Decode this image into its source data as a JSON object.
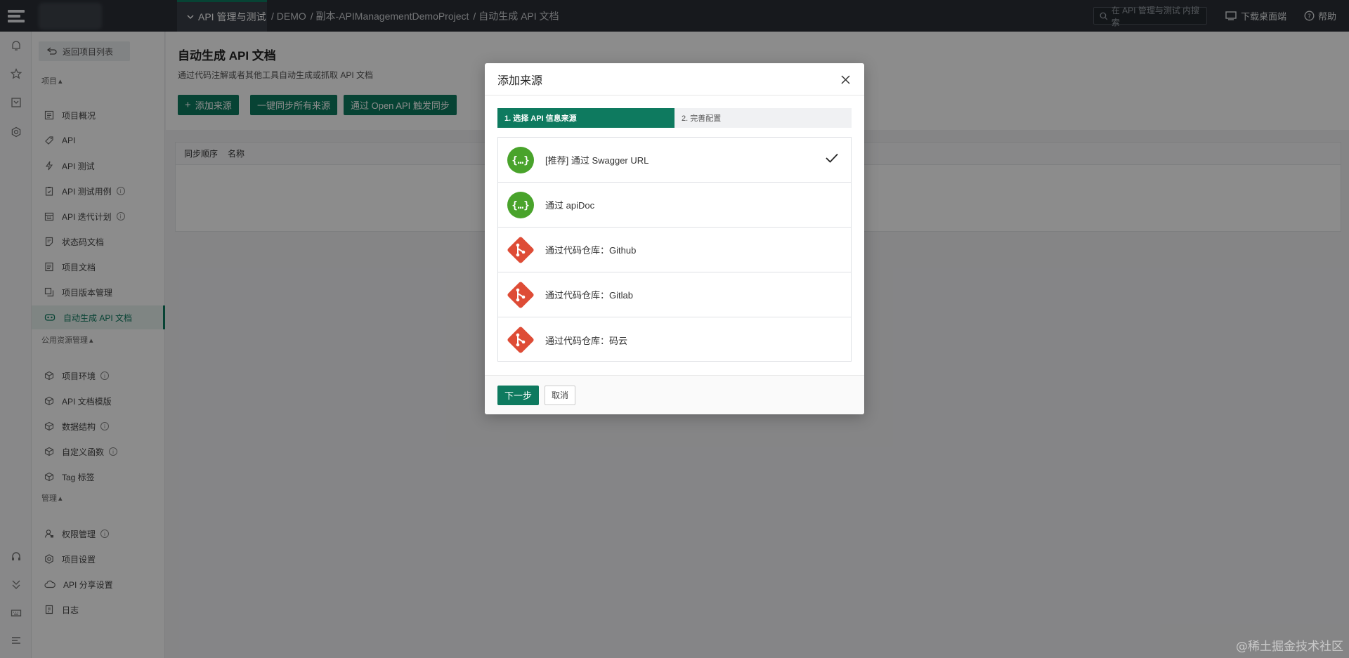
{
  "topbar": {
    "module_label": "API 管理与测试",
    "breadcrumbs": [
      "/ DEMO",
      "/ 副本-APIManagementDemoProject",
      "/ 自动生成 API 文档"
    ],
    "search_placeholder": "在 API 管理与测试 内搜索",
    "download_label": "下载桌面端",
    "help_label": "帮助"
  },
  "sidebar": {
    "back_label": "返回项目列表",
    "sections": [
      {
        "label": "项目",
        "items": [
          {
            "label": "项目概况",
            "icon": "overview-icon",
            "info": false
          },
          {
            "label": "API",
            "icon": "api-tag-icon",
            "info": false
          },
          {
            "label": "API 测试",
            "icon": "lightning-icon",
            "info": false
          },
          {
            "label": "API 测试用例",
            "icon": "clipboard-icon",
            "info": true
          },
          {
            "label": "API 迭代计划",
            "icon": "calendar-icon",
            "info": true
          },
          {
            "label": "状态码文档",
            "icon": "code-doc-icon",
            "info": false
          },
          {
            "label": "项目文档",
            "icon": "document-icon",
            "info": false
          },
          {
            "label": "项目版本管理",
            "icon": "version-icon",
            "info": false
          },
          {
            "label": "自动生成 API 文档",
            "icon": "robot-icon",
            "info": false,
            "active": true
          }
        ]
      },
      {
        "label": "公用资源管理",
        "items": [
          {
            "label": "项目环境",
            "icon": "cube-icon",
            "info": true
          },
          {
            "label": "API 文档模版",
            "icon": "cube-icon",
            "info": false
          },
          {
            "label": "数据结构",
            "icon": "cube-icon",
            "info": true
          },
          {
            "label": "自定义函数",
            "icon": "cube-icon",
            "info": true
          },
          {
            "label": "Tag 标签",
            "icon": "cube-icon",
            "info": false
          }
        ]
      },
      {
        "label": "管理",
        "items": [
          {
            "label": "权限管理",
            "icon": "user-lock-icon",
            "info": true
          },
          {
            "label": "项目设置",
            "icon": "gear-icon",
            "info": false
          },
          {
            "label": "API 分享设置",
            "icon": "cloud-icon",
            "info": false
          },
          {
            "label": "日志",
            "icon": "log-icon",
            "info": false
          }
        ]
      }
    ]
  },
  "main": {
    "title": "自动生成 API 文档",
    "description": "通过代码注解或者其他工具自动生成或抓取 API 文档",
    "buttons": {
      "add_source": "添加来源",
      "sync_all": "一键同步所有来源",
      "open_api_sync": "通过 Open API 触发同步"
    },
    "table_headers": [
      "同步顺序",
      "名称"
    ]
  },
  "modal": {
    "title": "添加来源",
    "steps": [
      "1. 选择 API 信息来源",
      "2. 完善配置"
    ],
    "sources": [
      {
        "label": "[推荐] 通过 Swagger URL",
        "icon": "swagger-icon",
        "selected": true
      },
      {
        "label": "通过 apiDoc",
        "icon": "swagger-icon",
        "selected": false
      },
      {
        "label": "通过代码仓库：Github",
        "icon": "git-icon",
        "selected": false
      },
      {
        "label": "通过代码仓库：Gitlab",
        "icon": "git-icon",
        "selected": false
      },
      {
        "label": "通过代码仓库：码云",
        "icon": "git-icon",
        "selected": false
      }
    ],
    "next_label": "下一步",
    "cancel_label": "取消"
  },
  "watermark": "@稀土掘金技术社区",
  "colors": {
    "accent": "#0e7a5f",
    "swagger": "#49a32b",
    "git": "#de4c36",
    "topbar": "#2b2f36"
  }
}
